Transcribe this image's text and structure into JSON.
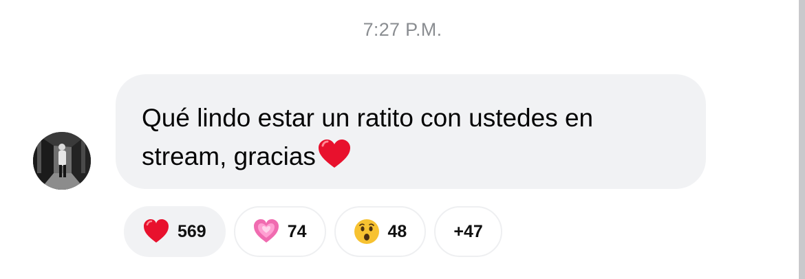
{
  "timestamp": "7:27 P.M.",
  "message": {
    "text": "Qué lindo estar un ratito con ustedes en stream, gracias",
    "trailing_emoji": "red-heart"
  },
  "reactions": [
    {
      "emoji": "red-heart",
      "count": "569",
      "selected": true
    },
    {
      "emoji": "sparkling-pink-heart",
      "count": "74",
      "selected": false
    },
    {
      "emoji": "surprised-face",
      "count": "48",
      "selected": false
    }
  ],
  "more_reactions": "+47",
  "colors": {
    "bubble_bg": "#f1f2f4",
    "timestamp": "#8a8d91",
    "heart_red": "#e8112d",
    "pink_heart": "#f06bb0",
    "face_yellow": "#f7c231"
  }
}
